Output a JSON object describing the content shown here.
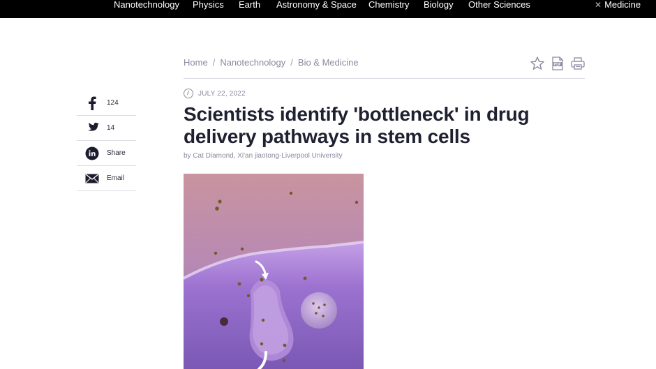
{
  "topnav": {
    "items": [
      "Nanotechnology",
      "Physics",
      "Earth",
      "Astronomy & Space",
      "Chemistry",
      "Biology",
      "Other Sciences"
    ],
    "active_close_icon": "close-icon",
    "active": "Medicine"
  },
  "breadcrumb": {
    "home": "Home",
    "category": "Nanotechnology",
    "subcategory": "Bio & Medicine",
    "separator": "/"
  },
  "tools": {
    "icons": [
      "star-icon",
      "pdf-icon",
      "print-icon"
    ]
  },
  "article": {
    "date": "JULY 22, 2022",
    "title": "Scientists identify 'bottleneck' in drug delivery pathways in stem cells",
    "byline": "by Cat Diamond, Xi'an jiaotong-Liverpool University"
  },
  "share": {
    "facebook": {
      "icon": "facebook-icon",
      "label": "124"
    },
    "twitter": {
      "icon": "twitter-icon",
      "label": "14"
    },
    "linkedin": {
      "icon": "linkedin-icon",
      "label": "Share"
    },
    "email": {
      "icon": "email-icon",
      "label": "Email"
    }
  },
  "colors": {
    "nav_bg": "#000000",
    "title": "#1f2030",
    "muted": "#8a8aa0",
    "hero_top": "#c99ba8",
    "hero_cell": "#9a6fc8"
  }
}
